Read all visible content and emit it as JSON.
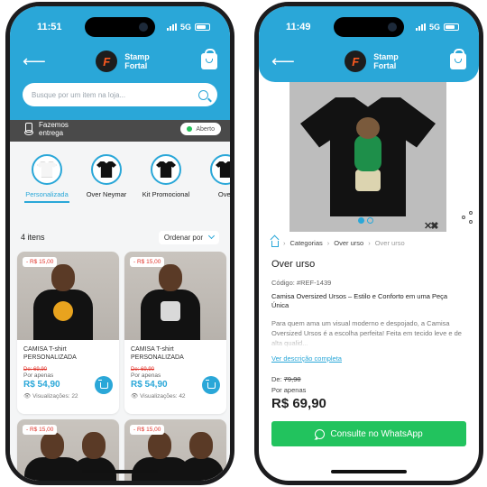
{
  "colors": {
    "accent": "#2aa7d8",
    "delivery_bar": "#4a4a4a",
    "discount": "#e0342b",
    "whatsapp": "#22c35e",
    "open_dot": "#24c05a"
  },
  "left": {
    "status": {
      "time": "11:51",
      "network": "5G"
    },
    "brand": {
      "line1": "Stamp",
      "line2": "Fortal"
    },
    "search": {
      "placeholder": "Busque por um item na loja..."
    },
    "delivery": {
      "line1": "Fazemos",
      "line2": "entrega",
      "badge": "Aberto"
    },
    "categories": [
      {
        "label": "Personalizada",
        "active": true
      },
      {
        "label": "Over Neymar",
        "active": false
      },
      {
        "label": "Kit Promocional",
        "active": false
      },
      {
        "label": "Over",
        "active": false
      }
    ],
    "list": {
      "count": "4 itens",
      "sort_label": "Ordenar por"
    },
    "products": [
      {
        "discount": "- R$ 15,00",
        "title": "CAMISA T-shirt PERSONALIZADA",
        "old_price": "De: 69,90",
        "por": "Por apenas",
        "price": "R$ 54,90",
        "views": "Visualizações: 22",
        "print_color": "#e8a31e"
      },
      {
        "discount": "- R$ 15,00",
        "title": "CAMISA T-shirt PERSONALIZADA",
        "old_price": "De: 69,90",
        "por": "Por apenas",
        "price": "R$ 54,90",
        "views": "Visualizações: 42",
        "print_color": "#d9d9d9"
      },
      {
        "discount": "- R$ 15,00"
      },
      {
        "discount": "- R$ 15,00"
      }
    ]
  },
  "right": {
    "status": {
      "time": "11:49",
      "network": "5G"
    },
    "brand": {
      "line1": "Stamp",
      "line2": "Fortal"
    },
    "breadcrumb": {
      "categorias": "Categorias",
      "over": "Over urso",
      "current": "Over urso"
    },
    "product": {
      "title": "Over urso",
      "code": "Código: #REF-1439",
      "subtitle": "Camisa Oversized Ursos – Estilo e Conforto em uma Peça Única",
      "description": "Para quem ama um visual moderno e despojado, a Camisa Oversized Ursos é a escolha perfeita! Feita em tecido leve e de alta qualid...",
      "more_link": "Ver descrição completa",
      "old_prefix": "De:",
      "old_price": "79,90",
      "por": "Por apenas",
      "price": "R$ 69,90",
      "cta": "Consulte no WhatsApp"
    }
  }
}
